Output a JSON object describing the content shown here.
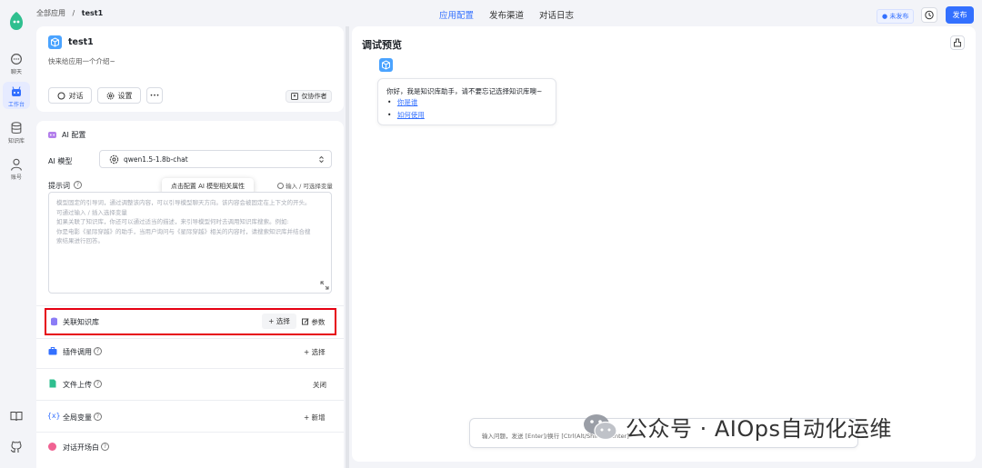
{
  "nav": {
    "items": [
      {
        "label": "聊天",
        "icon": "chat-icon"
      },
      {
        "label": "工作台",
        "icon": "robot-icon"
      },
      {
        "label": "知识库",
        "icon": "database-icon"
      },
      {
        "label": "账号",
        "icon": "user-icon"
      }
    ],
    "bottom_icons": [
      "book-icon",
      "github-icon"
    ]
  },
  "header": {
    "crumb_root": "全部应用",
    "crumb_sep": "/",
    "crumb_current": "test1",
    "tabs": [
      "应用配置",
      "发布渠道",
      "对话日志"
    ],
    "active_tab": "应用配置",
    "status_badge": "● 未发布",
    "publish_label": "发布"
  },
  "app": {
    "name": "test1",
    "intro": "快来给应用一个介绍~",
    "btn_chat": "对话",
    "btn_settings": "设置",
    "btn_more": "•••",
    "visibility": "仅协作者"
  },
  "config": {
    "section_title": "AI 配置",
    "model_label": "AI 模型",
    "model_value": "qwen1.5-1.8b-chat",
    "prompt_label": "提示词",
    "prompt_hint": "输入 / 可选择变量",
    "tooltip": "点击配置 AI 模型相关属性",
    "prompt_placeholder": [
      "模型固定的引导词，通过调整该内容，可以引导模型聊天方向。该内容会被固定在上下文的开头。",
      "可通过输入 / 插入选择变量",
      "如果关联了知识库，你还可以通过适当的描述，来引导模型何时去调用知识库搜索。例如:",
      "你是电影《星际穿越》的助手，当用户询问与《星际穿越》相关的内容时，请搜索知识库并结合搜",
      "索结果进行回答。"
    ],
    "kb_label": "关联知识库",
    "kb_select": "+ 选择",
    "kb_params": "参数",
    "plugin_label": "插件调用",
    "plugin_select": "+ 选择",
    "file_label": "文件上传",
    "file_value": "关闭",
    "vars_label": "全局变量",
    "vars_add": "+ 新增",
    "opening_label": "对话开场白"
  },
  "preview": {
    "title": "调试预览",
    "greeting": "你好，我是知识库助手，请不要忘记选择知识库噢~",
    "links": [
      "你是谁",
      "如何使用"
    ],
    "input_placeholder": "输入问题，发送 [Enter]/换行 [Ctrl(Alt/Shift) + Enter]"
  },
  "watermark": "公众号 · AIOps自动化运维",
  "colors": {
    "accent": "#3370ff",
    "highlight": "#e60012"
  }
}
